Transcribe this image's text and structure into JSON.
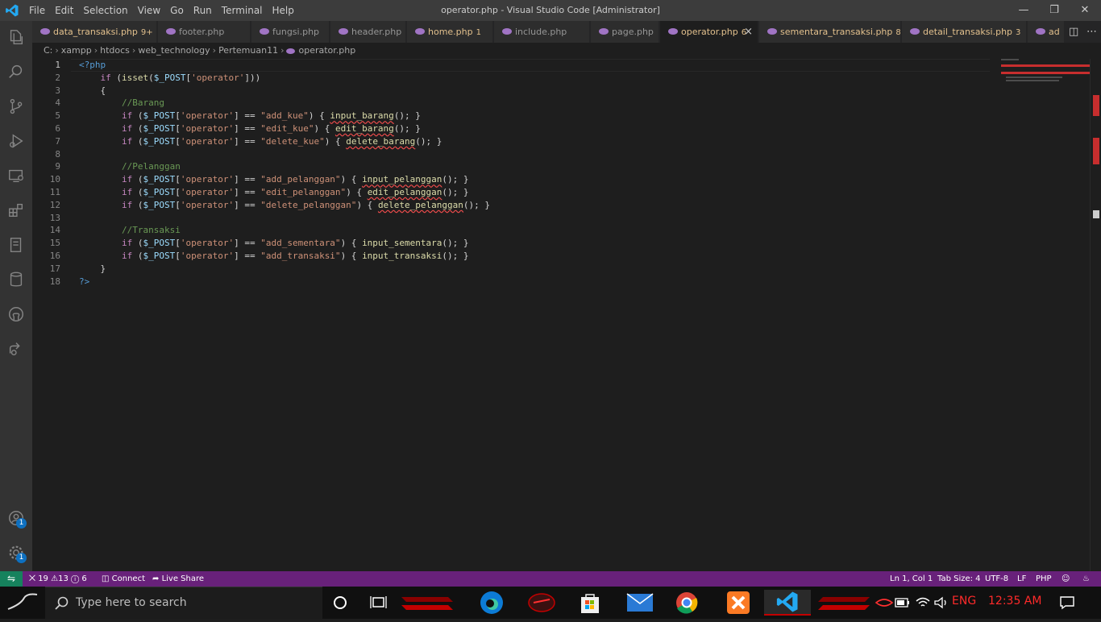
{
  "titlebar": {
    "menus": [
      "File",
      "Edit",
      "Selection",
      "View",
      "Go",
      "Run",
      "Terminal",
      "Help"
    ],
    "title": "operator.php - Visual Studio Code [Administrator]"
  },
  "tabs": [
    {
      "label": "data_transaksi.php",
      "count": "9+",
      "color": "#e2c08d",
      "active": false
    },
    {
      "label": "footer.php",
      "count": "",
      "color": "#969696",
      "active": false
    },
    {
      "label": "fungsi.php",
      "count": "",
      "color": "#969696",
      "active": false
    },
    {
      "label": "header.php",
      "count": "",
      "color": "#969696",
      "active": false
    },
    {
      "label": "home.php",
      "count": "1",
      "color": "#e2c08d",
      "active": false
    },
    {
      "label": "include.php",
      "count": "",
      "color": "#969696",
      "active": false
    },
    {
      "label": "page.php",
      "count": "",
      "color": "#969696",
      "active": false
    },
    {
      "label": "operator.php",
      "count": "6",
      "color": "#e2c08d",
      "active": true
    },
    {
      "label": "sementara_transaksi.php",
      "count": "8",
      "color": "#e2c08d",
      "active": false
    },
    {
      "label": "detail_transaksi.php",
      "count": "3",
      "color": "#e2c08d",
      "active": false
    },
    {
      "label": "ad",
      "count": "",
      "color": "#e2c08d",
      "active": false
    }
  ],
  "breadcrumb": [
    "C:",
    "xampp",
    "htdocs",
    "web_technology",
    "Pertemuan11",
    "operator.php"
  ],
  "editor": {
    "current_line": 1,
    "lines": [
      "<?php",
      "    if (isset($_POST['operator']))",
      "    {",
      "        //Barang",
      "        if ($_POST['operator'] == \"add_kue\") { input_barang(); }",
      "        if ($_POST['operator'] == \"edit_kue\") { edit_barang(); }",
      "        if ($_POST['operator'] == \"delete_kue\") { delete_barang(); }",
      "",
      "        //Pelanggan",
      "        if ($_POST['operator'] == \"add_pelanggan\") { input_pelanggan(); }",
      "        if ($_POST['operator'] == \"edit_pelanggan\") { edit_pelanggan(); }",
      "        if ($_POST['operator'] == \"delete_pelanggan\") { delete_pelanggan(); }",
      "",
      "        //Transaksi",
      "        if ($_POST['operator'] == \"add_sementara\") { input_sementara(); }",
      "        if ($_POST['operator'] == \"add_transaksi\") { input_transaksi(); }",
      "    }",
      "?>"
    ]
  },
  "statusbar": {
    "errors": "19",
    "warnings": "13",
    "infos": "6",
    "connect": "Connect",
    "live_share": "Live Share",
    "position": "Ln 1, Col 1",
    "tab_size": "Tab Size: 4",
    "encoding": "UTF-8",
    "eol": "LF",
    "language": "PHP"
  },
  "activity_badges": {
    "accounts": "1",
    "settings": "1"
  },
  "taskbar": {
    "search_placeholder": "Type here to search",
    "language": "ENG",
    "time": "12:35 AM"
  },
  "colors": {
    "statusbar": "#68217a",
    "accent": "#0e70c0",
    "error": "#f14c4c"
  }
}
